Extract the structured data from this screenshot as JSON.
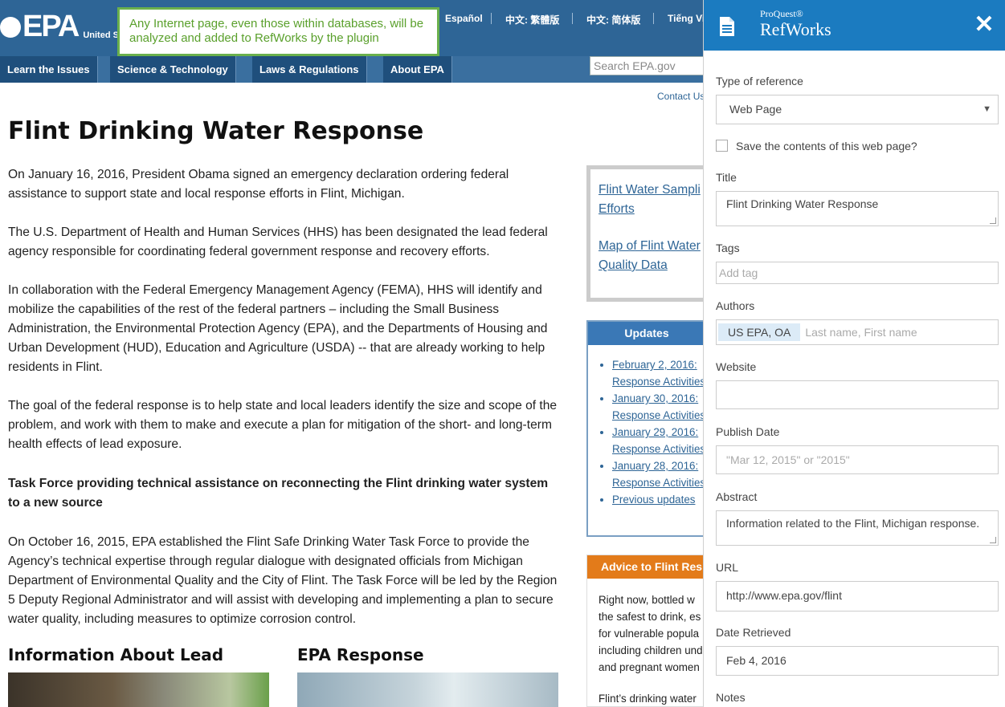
{
  "epa": {
    "logo_text": "EPA",
    "logo_sub": "United St",
    "tooltip": "Any Internet page, even those within databases, will be analyzed and added to RefWorks by the plugin",
    "languages": [
      "Español",
      "中文: 繁體版",
      "中文: 简体版",
      "Tiếng Vi"
    ],
    "nav": [
      "Learn the Issues",
      "Science & Technology",
      "Laws & Regulations",
      "About EPA"
    ],
    "search_placeholder": "Search EPA.gov",
    "contact": "Contact Us",
    "title": "Flint Drinking Water Response",
    "paragraphs": [
      "On January 16, 2016, President Obama signed an emergency declaration ordering federal assistance to support state and local response efforts in Flint, Michigan.",
      "The U.S. Department of Health and Human Services (HHS) has been designated the lead federal agency responsible for coordinating federal government response and recovery efforts.",
      "In collaboration with the Federal Emergency Management Agency (FEMA), HHS will identify and mobilize the capabilities of the rest of the federal partners – including the Small Business Administration, the Environmental Protection Agency (EPA), and the Departments of Housing and Urban Development (HUD), Education and Agriculture (USDA) -- that are already working to help residents in Flint.",
      "The goal of the federal response is to help state and local leaders identify the size and scope of the problem, and work with them to make and execute a plan for mitigation of the short- and long-term health effects of lead exposure."
    ],
    "subheading": "Task Force providing technical assistance on reconnecting the Flint drinking water system to a new source",
    "paragraph_task_force": "On October 16, 2015, EPA established the Flint Safe Drinking Water Task Force to provide the Agency’s technical expertise through regular dialogue with designated officials from Michigan Department of Environmental Quality and the City of Flint. The Task Force will be led by the Region 5 Deputy Regional Administrator and will assist with developing and implementing a plan to secure water quality, including measures to optimize corrosion control.",
    "section_lead": "Information About Lead",
    "section_response": "EPA Response",
    "side_links": [
      "Flint Water Sampli",
      "Efforts",
      "Map of Flint Water",
      "Quality Data"
    ],
    "updates_title": "Updates",
    "updates": [
      {
        "date": "February 2, 2016:",
        "text": "Response Activities"
      },
      {
        "date": "January 30, 2016:",
        "text": "Response Activities"
      },
      {
        "date": "January 29, 2016:",
        "text": "Response Activities"
      },
      {
        "date": "January 28, 2016:",
        "text": "Response Activities"
      },
      {
        "date": "Previous updates",
        "text": ""
      }
    ],
    "advice_title": "Advice to Flint Res",
    "advice_lines": [
      "Right now, bottled w",
      "the safest to drink, es",
      "for vulnerable popula",
      "including children und",
      "and pregnant women"
    ],
    "advice_footer": "Flint’s drinking water"
  },
  "refworks": {
    "brand_small": "ProQuest®",
    "brand": "RefWorks",
    "close": "✕",
    "type_label": "Type of reference",
    "type_value": "Web Page",
    "save_contents": "Save the contents of this web page?",
    "title_label": "Title",
    "title_value": "Flint Drinking Water Response",
    "tags_label": "Tags",
    "tags_placeholder": "Add tag",
    "authors_label": "Authors",
    "author_chip": "US EPA, OA",
    "authors_placeholder": "Last name, First name",
    "website_label": "Website",
    "website_value": "",
    "publish_label": "Publish Date",
    "publish_placeholder": "\"Mar 12, 2015\" or \"2015\"",
    "abstract_label": "Abstract",
    "abstract_value": "Information related to the Flint, Michigan response.",
    "url_label": "URL",
    "url_value": "http://www.epa.gov/flint",
    "retrieved_label": "Date Retrieved",
    "retrieved_value": "Feb 4, 2016",
    "notes_label": "Notes"
  },
  "colors": {
    "epa_blue": "#2e6596",
    "refworks_blue": "#1b7bc0",
    "tooltip_green": "#6ab04c",
    "advice_orange": "#e37b1a"
  }
}
